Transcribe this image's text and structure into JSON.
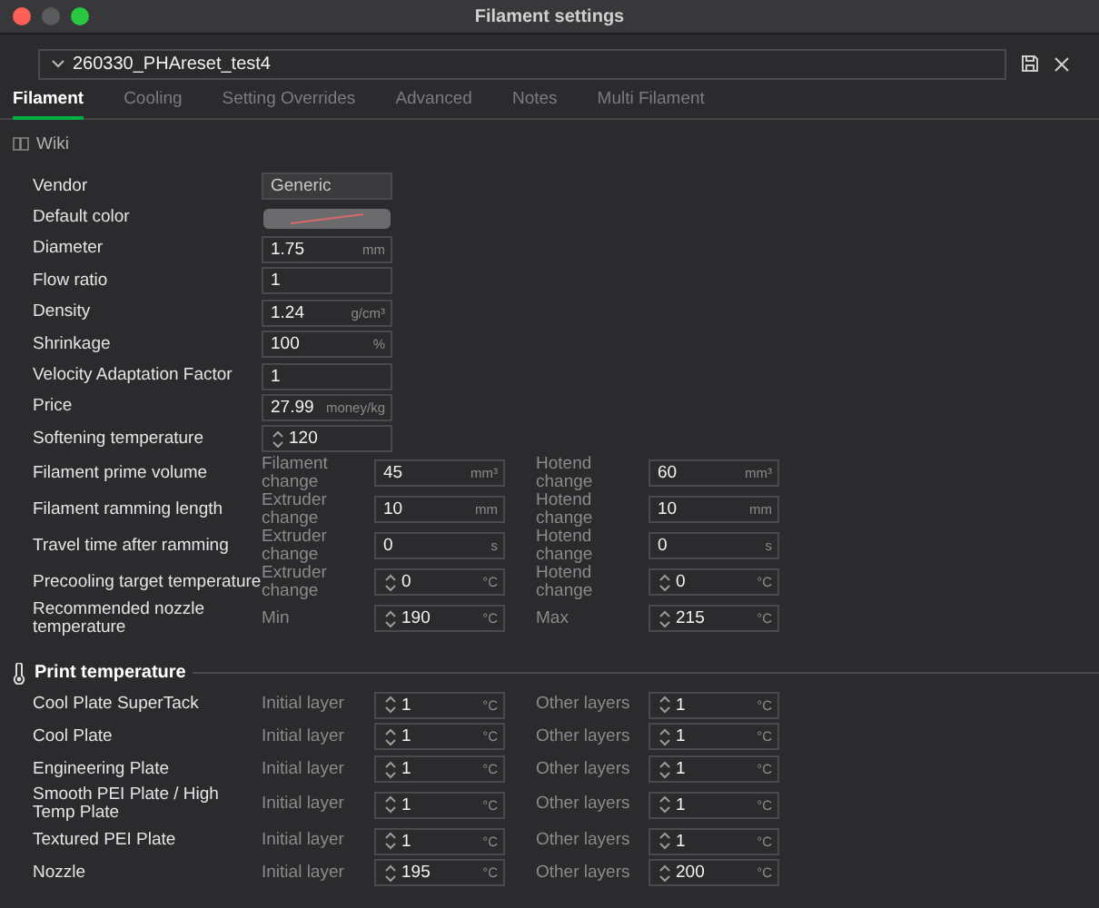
{
  "window": {
    "title": "Filament settings"
  },
  "preset": {
    "value": "260330_PHAreset_test4"
  },
  "tabs": [
    {
      "label": "Filament",
      "selected": true
    },
    {
      "label": "Cooling",
      "selected": false
    },
    {
      "label": "Setting Overrides",
      "selected": false
    },
    {
      "label": "Advanced",
      "selected": false
    },
    {
      "label": "Notes",
      "selected": false
    },
    {
      "label": "Multi Filament",
      "selected": false
    }
  ],
  "wiki": {
    "label": "Wiki"
  },
  "basic": [
    {
      "label": "Vendor",
      "kind": "combo",
      "value": "Generic"
    },
    {
      "label": "Default color",
      "kind": "color"
    },
    {
      "label": "Diameter",
      "kind": "field",
      "value": "1.75",
      "unit": "mm",
      "spin": false
    },
    {
      "label": "Flow ratio",
      "kind": "field",
      "value": "1",
      "spin": false
    },
    {
      "label": "Density",
      "kind": "field",
      "value": "1.24",
      "unit": "g/cm³",
      "spin": false
    },
    {
      "label": "Shrinkage",
      "kind": "field",
      "value": "100",
      "unit": "%",
      "spin": false
    },
    {
      "label": "Velocity Adaptation Factor",
      "kind": "field",
      "value": "1",
      "spin": false
    },
    {
      "label": "Price",
      "kind": "field",
      "value": "27.99",
      "unit": "money/kg",
      "spin": false
    },
    {
      "label": "Softening temperature",
      "kind": "field",
      "value": "120",
      "spin": true
    }
  ],
  "pairs": [
    {
      "label": "Filament prime volume",
      "left": {
        "label": "Filament change",
        "value": "45",
        "unit": "mm³",
        "spin": false
      },
      "right": {
        "label": "Hotend change",
        "value": "60",
        "unit": "mm³",
        "spin": false
      }
    },
    {
      "label": "Filament ramming length",
      "left": {
        "label": "Extruder change",
        "value": "10",
        "unit": "mm",
        "spin": false
      },
      "right": {
        "label": "Hotend change",
        "value": "10",
        "unit": "mm",
        "spin": false
      }
    },
    {
      "label": "Travel time after ramming",
      "left": {
        "label": "Extruder change",
        "value": "0",
        "unit": "s",
        "spin": false
      },
      "right": {
        "label": "Hotend change",
        "value": "0",
        "unit": "s",
        "spin": false
      }
    },
    {
      "label": "Precooling target temperature",
      "left": {
        "label": "Extruder change",
        "value": "0",
        "unit": "°C",
        "spin": true
      },
      "right": {
        "label": "Hotend change",
        "value": "0",
        "unit": "°C",
        "spin": true
      }
    },
    {
      "label": "Recommended nozzle temperature",
      "left": {
        "label": "Min",
        "value": "190",
        "unit": "°C",
        "spin": true
      },
      "right": {
        "label": "Max",
        "value": "215",
        "unit": "°C",
        "spin": true
      }
    }
  ],
  "print_temperature": {
    "title": "Print temperature",
    "rows": [
      {
        "label": "Cool Plate SuperTack",
        "left": {
          "label": "Initial layer",
          "value": "1",
          "unit": "°C",
          "spin": true
        },
        "right": {
          "label": "Other layers",
          "value": "1",
          "unit": "°C",
          "spin": true
        }
      },
      {
        "label": "Cool Plate",
        "left": {
          "label": "Initial layer",
          "value": "1",
          "unit": "°C",
          "spin": true
        },
        "right": {
          "label": "Other layers",
          "value": "1",
          "unit": "°C",
          "spin": true
        }
      },
      {
        "label": "Engineering Plate",
        "left": {
          "label": "Initial layer",
          "value": "1",
          "unit": "°C",
          "spin": true
        },
        "right": {
          "label": "Other layers",
          "value": "1",
          "unit": "°C",
          "spin": true
        }
      },
      {
        "label": "Smooth PEI Plate / High Temp Plate",
        "left": {
          "label": "Initial layer",
          "value": "1",
          "unit": "°C",
          "spin": true
        },
        "right": {
          "label": "Other layers",
          "value": "1",
          "unit": "°C",
          "spin": true
        }
      },
      {
        "label": "Textured PEI Plate",
        "left": {
          "label": "Initial layer",
          "value": "1",
          "unit": "°C",
          "spin": true
        },
        "right": {
          "label": "Other layers",
          "value": "1",
          "unit": "°C",
          "spin": true
        }
      },
      {
        "label": "Nozzle",
        "left": {
          "label": "Initial layer",
          "value": "195",
          "unit": "°C",
          "spin": true
        },
        "right": {
          "label": "Other layers",
          "value": "200",
          "unit": "°C",
          "spin": true
        }
      }
    ]
  }
}
